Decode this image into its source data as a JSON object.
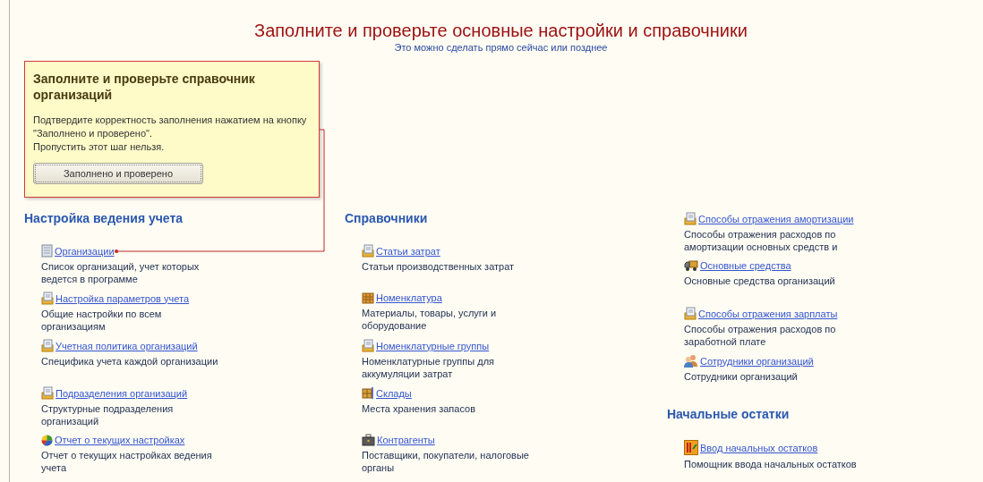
{
  "header": {
    "title": "Заполните и проверьте основные настройки и справочники",
    "subtitle": "Это можно сделать прямо сейчас или позднее"
  },
  "callout": {
    "title": "Заполните и проверьте справочник организаций",
    "lines": [
      "Подтвердите корректность заполнения нажатием на кнопку \"Заполнено и проверено\".",
      "Пропустить этот шаг нельзя."
    ],
    "button": "Заполнено и проверено"
  },
  "columns": [
    {
      "heading": "Настройка ведения учета",
      "items": [
        {
          "kind": "list",
          "link": "Организации",
          "description": "Список организаций, учет которых ведется в программе"
        },
        {
          "kind": "docs",
          "link": "Настройка параметров учета",
          "description": "Общие настройки по всем организациям"
        },
        {
          "kind": "docs",
          "link": "Учетная политика организаций",
          "description": "Специфика учета каждой организации"
        },
        {
          "kind": "docs",
          "link": "Подразделения организаций",
          "description": "Структурные подразделения организаций"
        },
        {
          "kind": "report",
          "link": "Отчет о текущих настройках",
          "description": "Отчет о текущих настройках ведения учета"
        }
      ]
    },
    {
      "heading": "Справочники",
      "items": [
        {
          "kind": "docs",
          "link": "Статьи затрат",
          "description": "Статьи производственных затрат"
        },
        {
          "kind": "goods",
          "link": "Номенклатура",
          "description": "Материалы, товары, услуги и оборудование"
        },
        {
          "kind": "docs",
          "link": "Номенклатурные группы",
          "description": "Номенклатурные группы для аккумуляции затрат"
        },
        {
          "kind": "warehouse",
          "link": "Склады",
          "description": "Места хранения запасов"
        },
        {
          "kind": "case",
          "link": "Контрагенты",
          "description": "Поставщики, покупатели, налоговые органы"
        }
      ]
    },
    {
      "items": [
        {
          "kind": "docs",
          "link": "Способы отражения амортизации",
          "description": "Способы отражения расходов по амортизации основных средств и"
        },
        {
          "kind": "truck",
          "link": "Основные средства",
          "description": "Основные средства организаций"
        },
        {
          "kind": "docs",
          "link": "Способы отражения зарплаты",
          "description": "Способы отражения расходов по заработной плате"
        },
        {
          "kind": "people",
          "link": "Сотрудники организаций",
          "description": "Сотрудники организаций"
        }
      ]
    },
    {
      "heading": "Начальные остатки",
      "items": [
        {
          "kind": "wizard",
          "link": "Ввод начальных остатков",
          "description": "Помощник ввода начальных остатков"
        }
      ]
    }
  ]
}
